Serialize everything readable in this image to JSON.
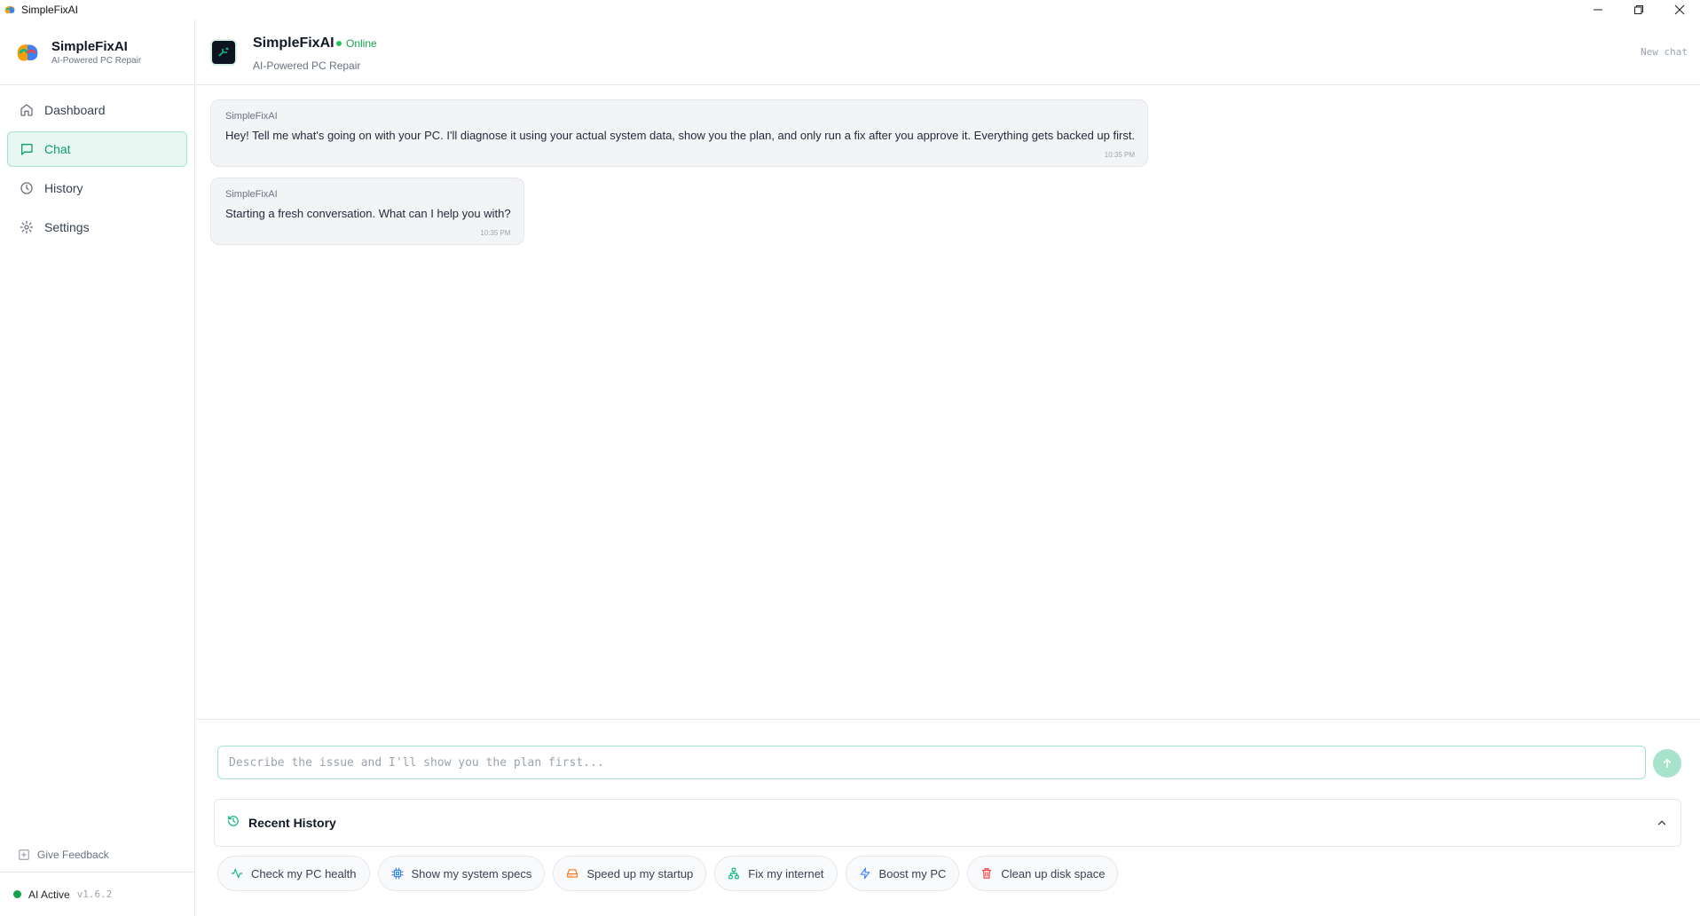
{
  "window": {
    "title": "SimpleFixAI",
    "controls": [
      "minimize-icon",
      "restore-icon",
      "close-icon"
    ]
  },
  "sidebar": {
    "brand": {
      "name": "SimpleFixAI",
      "subtitle": "AI-Powered PC Repair"
    },
    "items": [
      {
        "label": "Dashboard",
        "icon": "home-icon",
        "active": false
      },
      {
        "label": "Chat",
        "icon": "chat-icon",
        "active": true
      },
      {
        "label": "History",
        "icon": "clock-icon",
        "active": false
      },
      {
        "label": "Settings",
        "icon": "gear-icon",
        "active": false
      }
    ],
    "feedback_label": "Give Feedback",
    "status_label": "AI Active",
    "version": "v1.6.2"
  },
  "header": {
    "name": "SimpleFixAI",
    "status": "Online",
    "subtitle": "AI-Powered PC Repair",
    "new_chat_label": "New chat"
  },
  "messages": [
    {
      "sender": "SimpleFixAI",
      "text": "Hey! Tell me what's going on with your PC. I'll diagnose it using your actual system data, show you the plan, and only run a fix after you approve it. Everything gets backed up first.",
      "time": "10:35 PM"
    },
    {
      "sender": "SimpleFixAI",
      "text": "Starting a fresh conversation. What can I help you with?",
      "time": "10:35 PM"
    }
  ],
  "composer": {
    "placeholder": "Describe the issue and I'll show you the plan first...",
    "value": ""
  },
  "recent_history": {
    "label": "Recent History"
  },
  "quick_actions": [
    {
      "label": "Check my PC health",
      "icon": "activity-icon",
      "color": "#10b981"
    },
    {
      "label": "Show my system specs",
      "icon": "cpu-icon",
      "color": "#3b82f6"
    },
    {
      "label": "Speed up my startup",
      "icon": "drive-icon",
      "color": "#f97316"
    },
    {
      "label": "Fix my internet",
      "icon": "network-icon",
      "color": "#10b981"
    },
    {
      "label": "Boost my PC",
      "icon": "bolt-icon",
      "color": "#3b82f6"
    },
    {
      "label": "Clean up disk space",
      "icon": "trash-icon",
      "color": "#ef4444"
    }
  ],
  "colors": {
    "accent": "#10b981",
    "accent_soft": "#e8f7f1",
    "online": "#22c55e"
  }
}
